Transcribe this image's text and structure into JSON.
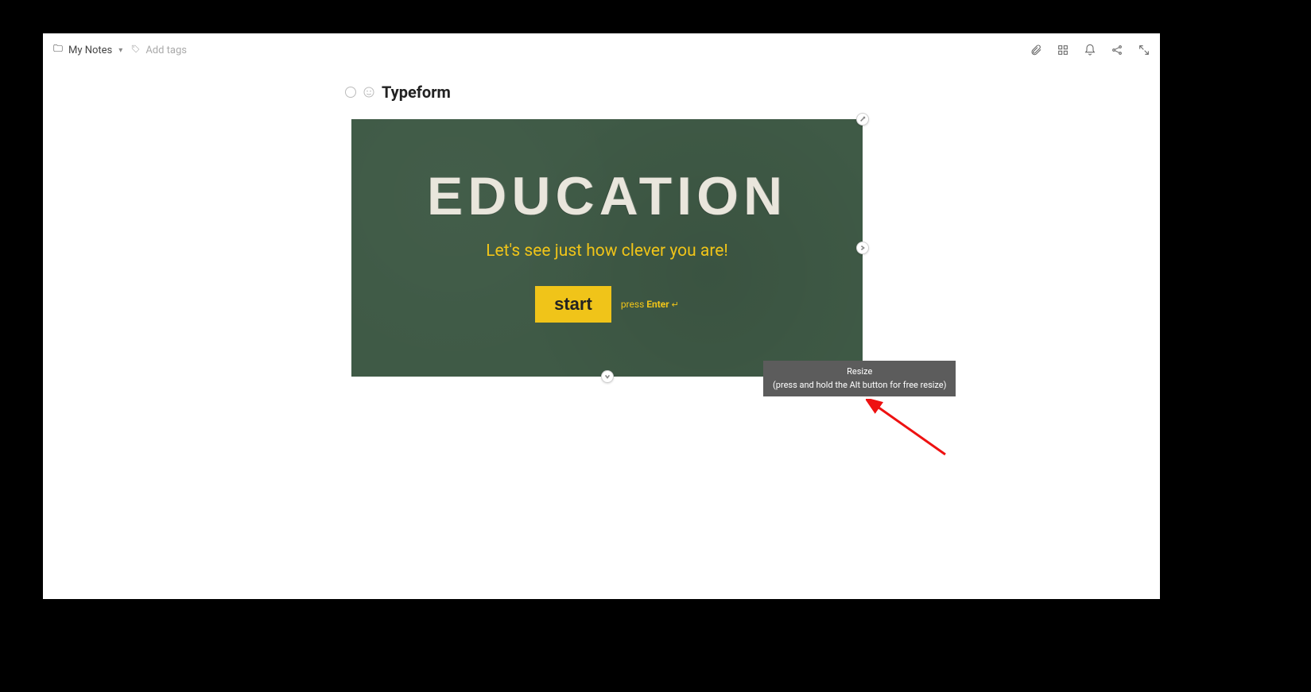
{
  "topbar": {
    "folder_label": "My Notes",
    "add_tags_label": "Add tags"
  },
  "note": {
    "title": "Typeform"
  },
  "embed": {
    "heading": "EDUCATION",
    "subtitle": "Let's see just how clever you are!",
    "start_label": "start",
    "hint_prefix": "press ",
    "hint_key": "Enter",
    "hint_glyph": "↵"
  },
  "tooltip": {
    "title": "Resize",
    "subtitle": "(press and hold the Alt button for free resize)"
  }
}
